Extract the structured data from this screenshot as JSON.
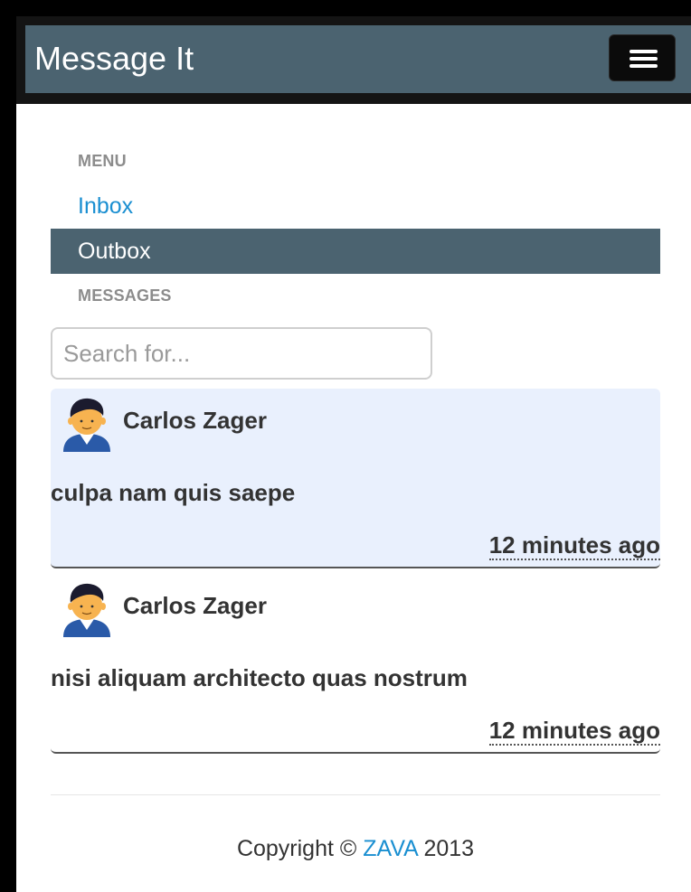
{
  "header": {
    "brand": "Message It",
    "menu_toggle_icon": "hamburger-menu-icon"
  },
  "sidebar": {
    "menu_header": "MENU",
    "items": [
      {
        "label": "Inbox",
        "active": false
      },
      {
        "label": "Outbox",
        "active": true
      }
    ],
    "messages_header": "MESSAGES"
  },
  "search": {
    "placeholder": "Search for...",
    "value": ""
  },
  "messages": [
    {
      "sender": "Carlos Zager",
      "avatar_icon": "user-avatar-icon",
      "subject": "culpa nam quis saepe",
      "time": "12 minutes ago",
      "highlighted": true
    },
    {
      "sender": "Carlos Zager",
      "avatar_icon": "user-avatar-icon",
      "subject": "nisi aliquam architecto quas nostrum",
      "time": "12 minutes ago",
      "highlighted": false
    }
  ],
  "footer": {
    "prefix": "Copyright ©",
    "company": "ZAVA",
    "year": "2013"
  },
  "colors": {
    "navbar": "#4b6370",
    "link": "#1a8fd1",
    "highlight": "#e9f0fd"
  }
}
